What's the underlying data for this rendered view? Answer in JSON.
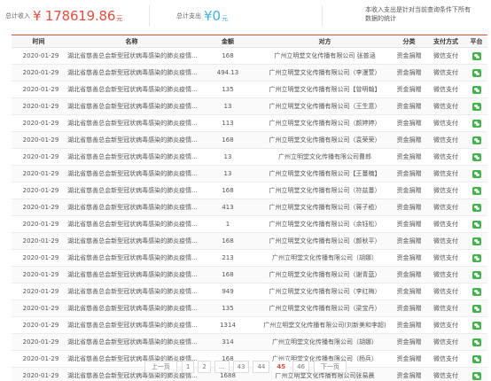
{
  "summary": {
    "income_label": "总计收入",
    "income_currency": "¥",
    "income_value": "178619.86",
    "income_unit": "元",
    "expense_label": "总计支出",
    "expense_currency": "¥",
    "expense_value": "0",
    "expense_unit": "元",
    "note": "本收入支出是针对当前查询条件下所有数据的统计"
  },
  "table": {
    "headers": [
      "时间",
      "名称",
      "金额",
      "对方",
      "分类",
      "支付方式",
      "平台"
    ],
    "rows": [
      {
        "date": "2020-01-29",
        "name": "湖北省慈善总会新型冠状病毒感染的肺炎疫情...",
        "amount": "168",
        "party": "广州立明堂文化传播有限公司 张普涵",
        "category": "资金捐赠",
        "pay": "微信支付"
      },
      {
        "date": "2020-01-29",
        "name": "湖北省慈善总会新型冠状病毒感染的肺炎疫情...",
        "amount": "494.13",
        "party": "广州立明堂文化传播有限公司（李漫萱）",
        "category": "资金捐赠",
        "pay": "微信支付"
      },
      {
        "date": "2020-01-29",
        "name": "湖北省慈善总会新型冠状病毒感染的肺炎疫情...",
        "amount": "135",
        "party": "广州立明堂文化传播有限公司【曾明翰】",
        "category": "资金捐赠",
        "pay": "微信支付"
      },
      {
        "date": "2020-01-29",
        "name": "湖北省慈善总会新型冠状病毒感染的肺炎疫情...",
        "amount": "13",
        "party": "广州立明堂文化传播有限公司（王生意）",
        "category": "资金捐赠",
        "pay": "微信支付"
      },
      {
        "date": "2020-01-29",
        "name": "湖北省慈善总会新型冠状病毒感染的肺炎疫情...",
        "amount": "113",
        "party": "广州立明堂文化传播有限公司（颜婷婷）",
        "category": "资金捐赠",
        "pay": "微信支付"
      },
      {
        "date": "2020-01-29",
        "name": "湖北省慈善总会新型冠状病毒感染的肺炎疫情...",
        "amount": "168",
        "party": "广州立明堂文化传播有限公司（袁荣荣）",
        "category": "资金捐赠",
        "pay": "微信支付"
      },
      {
        "date": "2020-01-29",
        "name": "湖北省慈善总会新型冠状病毒感染的肺炎疫情...",
        "amount": "13",
        "party": "广州立明堂文化传播有限公司曹郎",
        "category": "资金捐赠",
        "pay": "微信支付"
      },
      {
        "date": "2020-01-29",
        "name": "湖北省慈善总会新型冠状病毒感染的肺炎疫情...",
        "amount": "13",
        "party": "广州立明堂文化传播有限公司【王蔓楠】",
        "category": "资金捐赠",
        "pay": "微信支付"
      },
      {
        "date": "2020-01-29",
        "name": "湖北省慈善总会新型冠状病毒感染的肺炎疫情...",
        "amount": "168",
        "party": "广州立明堂文化传播有限公司（符兹蔓）",
        "category": "资金捐赠",
        "pay": "微信支付"
      },
      {
        "date": "2020-01-29",
        "name": "湖北省慈善总会新型冠状病毒感染的肺炎疫情...",
        "amount": "413",
        "party": "广州立明堂文化传播有限公司（蒋子榄）",
        "category": "资金捐赠",
        "pay": "微信支付"
      },
      {
        "date": "2020-01-29",
        "name": "湖北省慈善总会新型冠状病毒感染的肺炎疫情...",
        "amount": "1",
        "party": "广州立明堂文化传播有限公司（余钰松）",
        "category": "资金捐赠",
        "pay": "微信支付"
      },
      {
        "date": "2020-01-29",
        "name": "湖北省慈善总会新型冠状病毒感染的肺炎疫情...",
        "amount": "168",
        "party": "广州立明堂文化传播有限公司（颜秋平）",
        "category": "资金捐赠",
        "pay": "微信支付"
      },
      {
        "date": "2020-01-29",
        "name": "湖北省慈善总会新型冠状病毒感染的肺炎疫情...",
        "amount": "213",
        "party": "广州立明堂文化传播有限公司（胡娜）",
        "category": "资金捐赠",
        "pay": "微信支付"
      },
      {
        "date": "2020-01-29",
        "name": "湖北省慈善总会新型冠状病毒感染的肺炎疫情...",
        "amount": "168",
        "party": "广州立明堂文化传播有限公司（谢青蓝）",
        "category": "资金捐赠",
        "pay": "微信支付"
      },
      {
        "date": "2020-01-29",
        "name": "湖北省慈善总会新型冠状病毒感染的肺炎疫情...",
        "amount": "949",
        "party": "广州立明堂文化传播有限公司（李红梅）",
        "category": "资金捐赠",
        "pay": "微信支付"
      },
      {
        "date": "2020-01-29",
        "name": "湖北省慈善总会新型冠状病毒感染的肺炎疫情...",
        "amount": "135",
        "party": "广州立明堂文化传播有限公司（梁宝丹）",
        "category": "资金捐赠",
        "pay": "微信支付"
      },
      {
        "date": "2020-01-29",
        "name": "湖北省慈善总会新型冠状病毒感染的肺炎疫情...",
        "amount": "1314",
        "party": "广州立明堂文化传播有限公司(刘新美和李超)",
        "category": "资金捐赠",
        "pay": "微信支付"
      },
      {
        "date": "2020-01-29",
        "name": "湖北省慈善总会新型冠状病毒感染的肺炎疫情...",
        "amount": "314",
        "party": "广州立明堂文化传播有限公司（胡娜）",
        "category": "资金捐赠",
        "pay": "微信支付"
      },
      {
        "date": "2020-01-29",
        "name": "湖北省慈善总会新型冠状病毒感染的肺炎疫情...",
        "amount": "168",
        "party": "广州立明堂文化传播有限公司（杨兵）",
        "category": "资金捐赠",
        "pay": "微信支付"
      },
      {
        "date": "2020-01-29",
        "name": "湖北省慈善总会新型冠状病毒感染的肺炎疫情...",
        "amount": "1688",
        "party": "广州立明堂文化传播有限公司张易晨",
        "category": "资金捐赠",
        "pay": "微信支付"
      }
    ],
    "platform_icon": "wechat-icon"
  },
  "pagination": {
    "prev": "上一页",
    "pages": [
      "1",
      "2",
      "...",
      "43",
      "44",
      "45",
      "46"
    ],
    "current": "45",
    "next": "下一页"
  },
  "colors": {
    "accent_red": "#e84c3d",
    "expense_blue": "#3fb1e6",
    "amount_green": "#3cad3c",
    "wechat_green": "#43b44b"
  }
}
